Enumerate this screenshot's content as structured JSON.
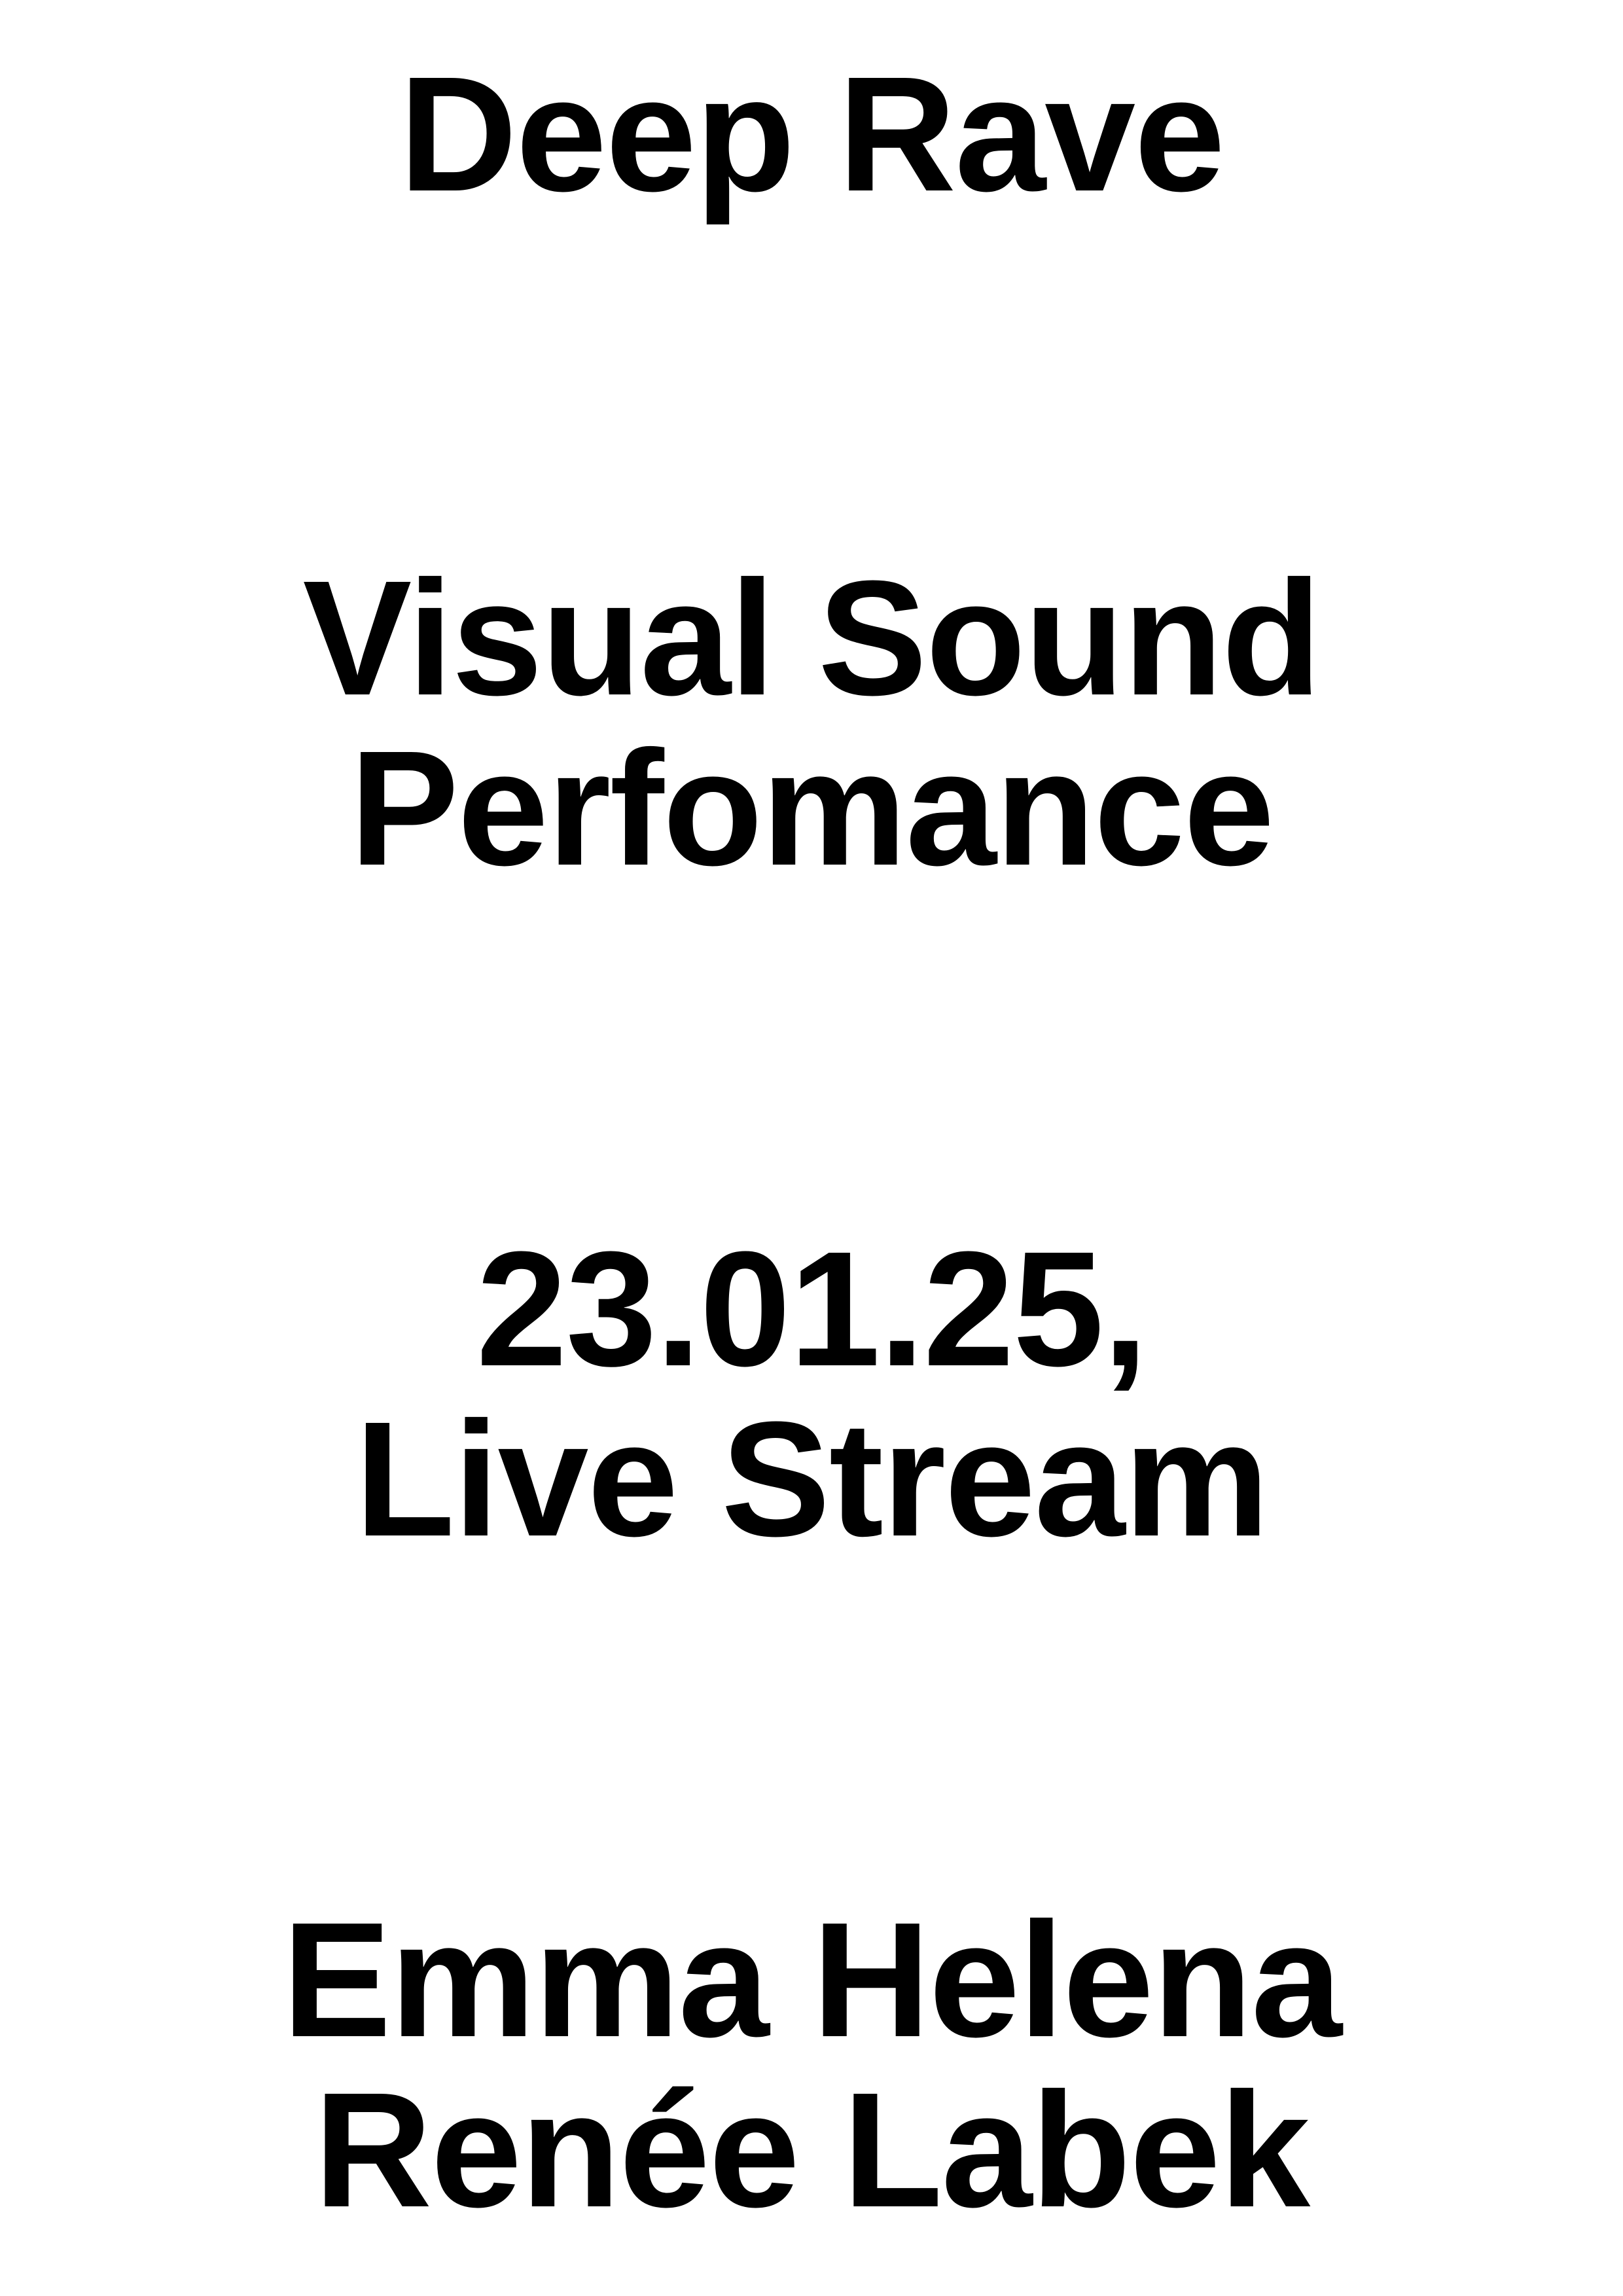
{
  "poster": {
    "title": "Deep Rave",
    "subtitle_line1": "Visual Sound",
    "subtitle_line2": "Perfomance",
    "date_line": "23.01.25,",
    "venue_line": "Live Stream",
    "artist_line1": "Emma Helena",
    "artist_line2": "Renée Labek",
    "colors": {
      "background": "#ffffff",
      "text": "#000000"
    }
  }
}
